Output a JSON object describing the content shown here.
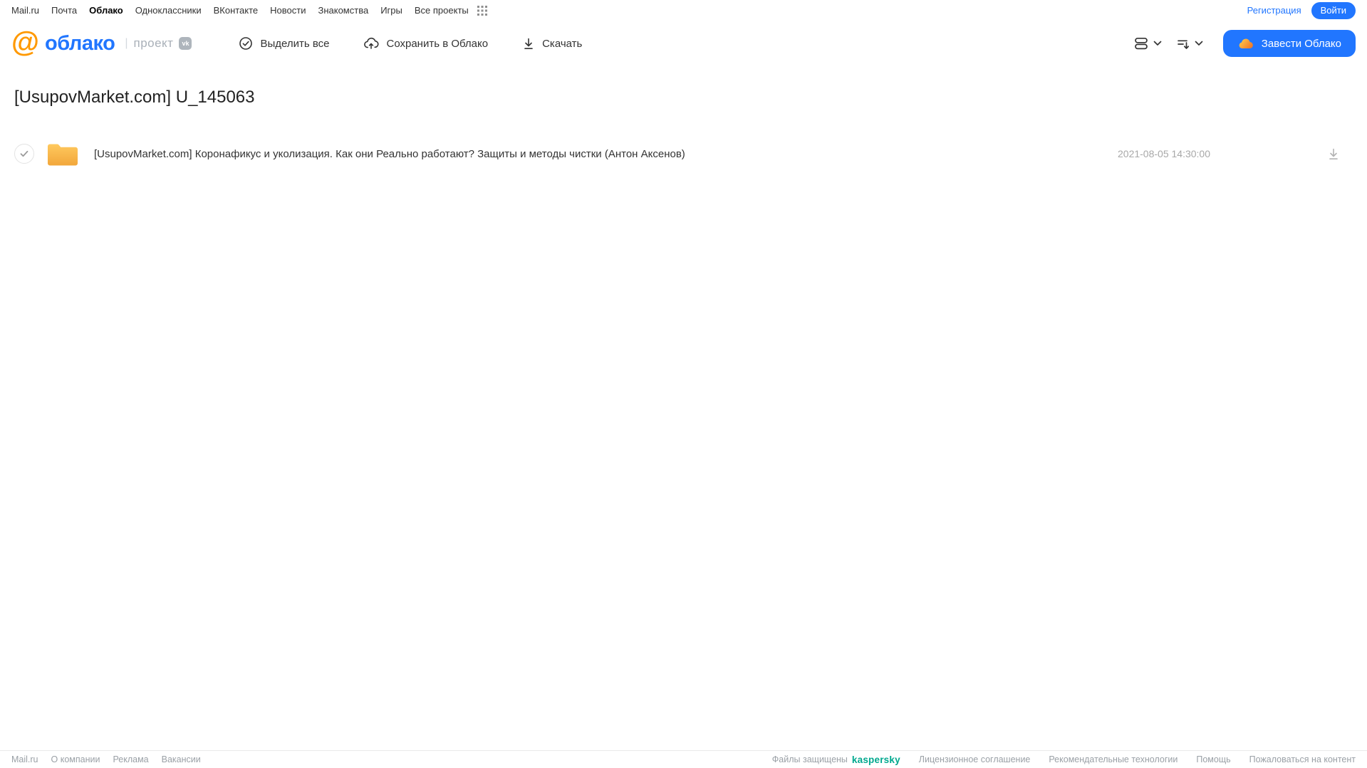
{
  "top_nav": {
    "links": [
      "Mail.ru",
      "Почта",
      "Облако",
      "Одноклассники",
      "ВКонтакте",
      "Новости",
      "Знакомства",
      "Игры",
      "Все проекты"
    ],
    "registration_label": "Регистрация",
    "login_label": "Войти"
  },
  "header": {
    "logo_at": "@",
    "logo_text": "облако",
    "project_divider": "|",
    "project_label": "проект",
    "vk_badge": "vk",
    "toolbar": {
      "select_all_label": "Выделить все",
      "save_to_cloud_label": "Сохранить в Облако",
      "download_label": "Скачать"
    },
    "create_cloud_label": "Завести Облако"
  },
  "page": {
    "title": "[UsupovMarket.com] U_145063"
  },
  "file_list": {
    "rows": [
      {
        "type": "folder",
        "name": "[UsupovMarket.com] Коронафикус и уколизация. Как они Реально работают? Защиты и методы чистки (Антон Аксенов)",
        "date": "2021-08-05 14:30:00"
      }
    ]
  },
  "footer": {
    "left_links": [
      "Mail.ru",
      "О компании",
      "Реклама",
      "Вакансии"
    ],
    "protected_text": "Файлы защищены",
    "kaspersky_label": "kaspersky",
    "right_links": [
      "Лицензионное соглашение",
      "Рекомендательные технологии",
      "Помощь",
      "Пожаловаться на контент"
    ]
  },
  "colors": {
    "accent_blue": "#2176ff",
    "brand_orange": "#ff9900",
    "folder_yellow_top": "#ffc95e",
    "folder_yellow_bottom": "#f2a73b",
    "kaspersky_teal": "#00a88e"
  }
}
